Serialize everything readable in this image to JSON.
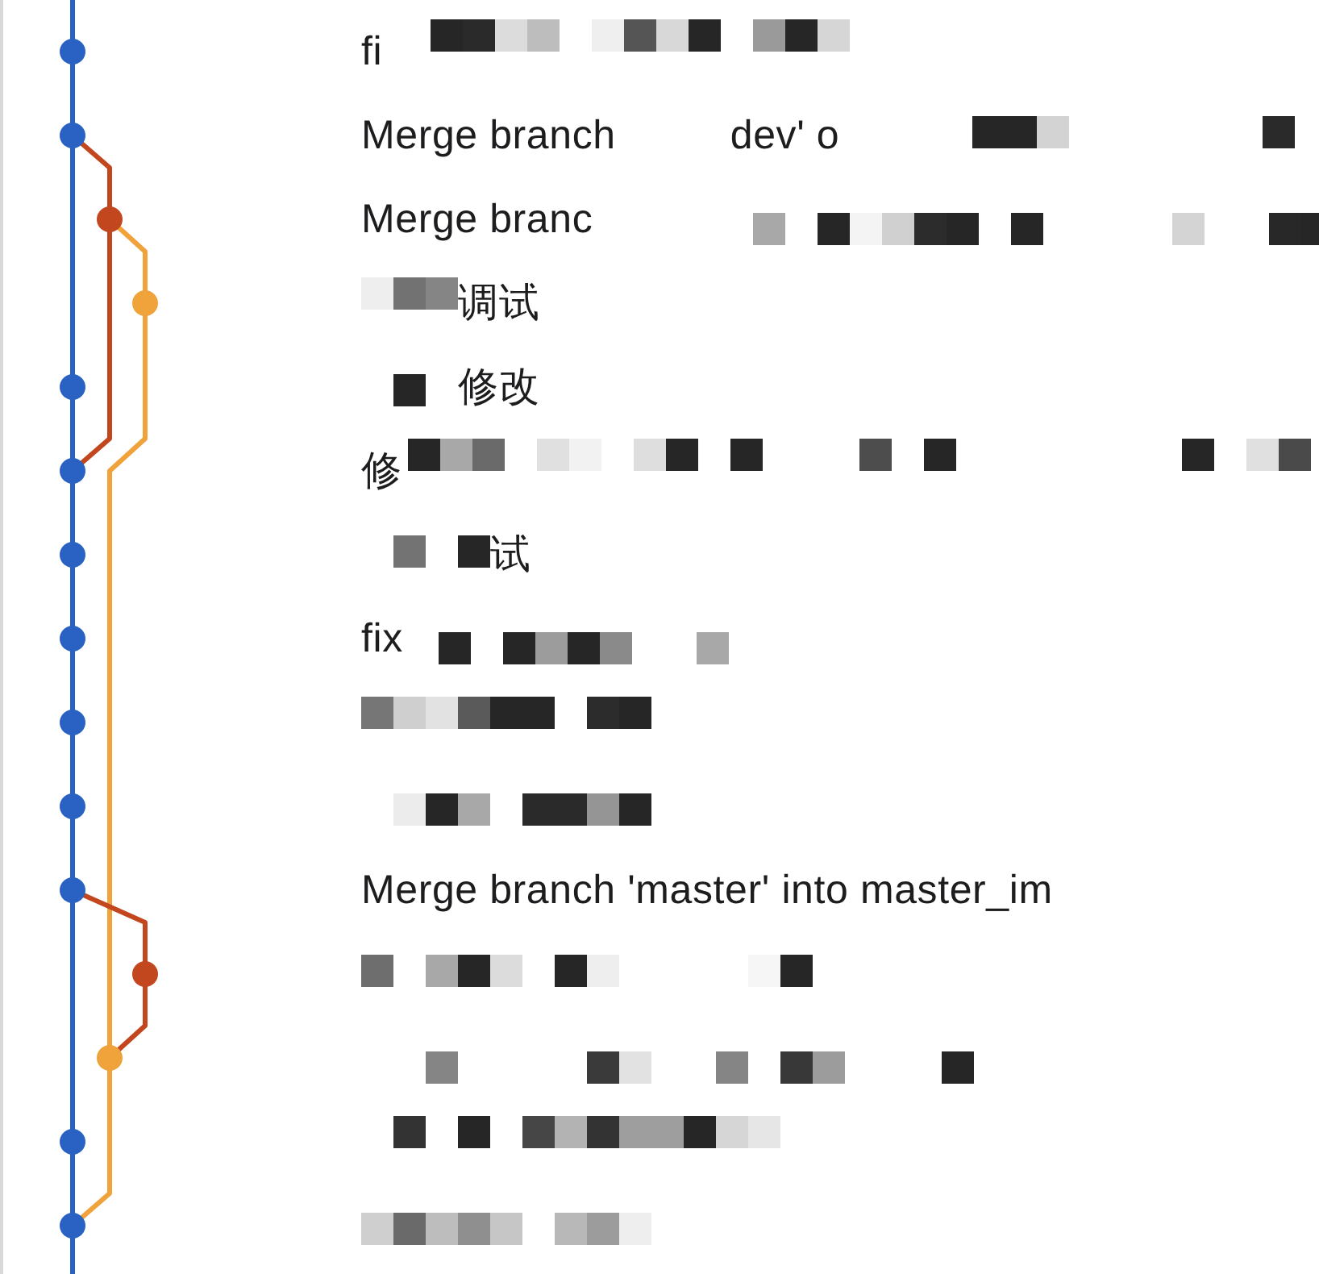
{
  "commits": [
    {
      "color": "#2a62c4",
      "kind": "main",
      "message": [
        {
          "kind": "text",
          "text": "fi"
        },
        {
          "kind": "mosaic",
          "tiles": [
            {
              "kind": "blank"
            },
            {
              "kind": "tile",
              "color": "#262626"
            },
            {
              "kind": "tile",
              "color": "#2a2a2a"
            },
            {
              "kind": "tile",
              "color": "#dcdcdc"
            },
            {
              "kind": "tile",
              "color": "#bdbdbd"
            },
            {
              "kind": "blank"
            },
            {
              "kind": "tile",
              "color": "#efefef"
            },
            {
              "kind": "tile",
              "color": "#555555"
            },
            {
              "kind": "tile",
              "color": "#d8d8d8"
            },
            {
              "kind": "tile",
              "color": "#262626"
            },
            {
              "kind": "blank"
            },
            {
              "kind": "tile",
              "color": "#9a9a9a"
            },
            {
              "kind": "tile",
              "color": "#262626"
            },
            {
              "kind": "tile",
              "color": "#d6d6d6"
            }
          ]
        }
      ]
    },
    {
      "color": "#2a62c4",
      "kind": "main",
      "message": [
        {
          "kind": "text",
          "text": "Merge branch"
        },
        {
          "kind": "mosaic",
          "tiles": [
            {
              "kind": "blank"
            },
            {
              "kind": "blank"
            },
            {
              "kind": "blank"
            }
          ]
        },
        {
          "kind": "text",
          "text": "dev' o"
        },
        {
          "kind": "mosaic",
          "tiles": [
            {
              "kind": "blank"
            },
            {
              "kind": "blank"
            },
            {
              "kind": "blank"
            },
            {
              "kind": "blank"
            },
            {
              "kind": "tile",
              "color": "#262626"
            },
            {
              "kind": "tile",
              "color": "#262626"
            },
            {
              "kind": "tile",
              "color": "#d3d3d3"
            },
            {
              "kind": "blank"
            },
            {
              "kind": "blank"
            },
            {
              "kind": "blank"
            },
            {
              "kind": "blank"
            },
            {
              "kind": "blank"
            },
            {
              "kind": "blank"
            },
            {
              "kind": "tile",
              "color": "#2a2a2a"
            }
          ]
        }
      ]
    },
    {
      "color": "#c2461e",
      "kind": "inner",
      "message": [
        {
          "kind": "text",
          "text": "Merge branc"
        },
        {
          "kind": "mosaic",
          "tiles": [
            {
              "kind": "blank"
            },
            {
              "kind": "blank"
            },
            {
              "kind": "blank"
            },
            {
              "kind": "blank"
            },
            {
              "kind": "tile",
              "color": "#a8a8a8"
            },
            {
              "kind": "blank"
            },
            {
              "kind": "tile",
              "color": "#262626"
            },
            {
              "kind": "tile",
              "color": "#f4f4f4"
            },
            {
              "kind": "tile",
              "color": "#d0d0d0"
            },
            {
              "kind": "tile",
              "color": "#2c2c2c"
            },
            {
              "kind": "tile",
              "color": "#262626"
            },
            {
              "kind": "blank"
            },
            {
              "kind": "tile",
              "color": "#262626"
            },
            {
              "kind": "blank"
            },
            {
              "kind": "blank"
            },
            {
              "kind": "blank"
            },
            {
              "kind": "blank"
            },
            {
              "kind": "tile",
              "color": "#d4d4d4"
            },
            {
              "kind": "blank"
            },
            {
              "kind": "blank"
            },
            {
              "kind": "tile",
              "color": "#282828"
            },
            {
              "kind": "tile",
              "color": "#262626"
            }
          ]
        }
      ]
    },
    {
      "color": "#f0a23b",
      "kind": "outer",
      "message": [
        {
          "kind": "mosaic",
          "tiles": [
            {
              "kind": "tile",
              "color": "#eeeeee"
            },
            {
              "kind": "tile",
              "color": "#727272"
            },
            {
              "kind": "tile",
              "color": "#858585"
            }
          ]
        },
        {
          "kind": "text",
          "text": "调试"
        }
      ]
    },
    {
      "color": "#2a62c4",
      "kind": "main",
      "message": [
        {
          "kind": "mosaic",
          "tiles": [
            {
              "kind": "blank"
            },
            {
              "kind": "tile",
              "color": "#262626"
            },
            {
              "kind": "blank"
            }
          ]
        },
        {
          "kind": "text",
          "text": "修改"
        }
      ]
    },
    {
      "color": "#2a62c4",
      "kind": "main",
      "message": [
        {
          "kind": "text",
          "text": "修"
        },
        {
          "kind": "mosaic",
          "tiles": [
            {
              "kind": "tile",
              "color": "#262626"
            },
            {
              "kind": "tile",
              "color": "#a8a8a8"
            },
            {
              "kind": "tile",
              "color": "#6a6a6a"
            },
            {
              "kind": "blank"
            },
            {
              "kind": "tile",
              "color": "#e0e0e0"
            },
            {
              "kind": "tile",
              "color": "#f2f2f2"
            },
            {
              "kind": "blank"
            },
            {
              "kind": "tile",
              "color": "#dedede"
            },
            {
              "kind": "tile",
              "color": "#262626"
            },
            {
              "kind": "blank"
            },
            {
              "kind": "tile",
              "color": "#262626"
            },
            {
              "kind": "blank"
            },
            {
              "kind": "blank"
            },
            {
              "kind": "blank"
            },
            {
              "kind": "tile",
              "color": "#4d4d4d"
            },
            {
              "kind": "blank"
            },
            {
              "kind": "tile",
              "color": "#262626"
            },
            {
              "kind": "blank"
            },
            {
              "kind": "blank"
            },
            {
              "kind": "blank"
            },
            {
              "kind": "blank"
            },
            {
              "kind": "blank"
            },
            {
              "kind": "blank"
            },
            {
              "kind": "blank"
            },
            {
              "kind": "tile",
              "color": "#262626"
            },
            {
              "kind": "blank"
            },
            {
              "kind": "tile",
              "color": "#e0e0e0"
            },
            {
              "kind": "tile",
              "color": "#4a4a4a"
            }
          ]
        }
      ]
    },
    {
      "color": "#2a62c4",
      "kind": "main",
      "message": [
        {
          "kind": "mosaic",
          "tiles": [
            {
              "kind": "blank"
            },
            {
              "kind": "tile",
              "color": "#737373"
            },
            {
              "kind": "blank"
            },
            {
              "kind": "tile",
              "color": "#262626"
            }
          ]
        },
        {
          "kind": "text",
          "text": "试"
        }
      ]
    },
    {
      "color": "#2a62c4",
      "kind": "main",
      "message": [
        {
          "kind": "text",
          "text": "fix"
        },
        {
          "kind": "mosaic",
          "tiles": [
            {
              "kind": "blank"
            },
            {
              "kind": "tile",
              "color": "#262626"
            },
            {
              "kind": "blank"
            },
            {
              "kind": "tile",
              "color": "#262626"
            },
            {
              "kind": "tile",
              "color": "#9c9c9c"
            },
            {
              "kind": "tile",
              "color": "#262626"
            },
            {
              "kind": "tile",
              "color": "#8a8a8a"
            },
            {
              "kind": "blank"
            },
            {
              "kind": "blank"
            },
            {
              "kind": "tile",
              "color": "#a8a8a8"
            }
          ]
        }
      ]
    },
    {
      "color": "#2a62c4",
      "kind": "main",
      "message": [
        {
          "kind": "mosaic",
          "tiles": [
            {
              "kind": "tile",
              "color": "#767676"
            },
            {
              "kind": "tile",
              "color": "#cfcfcf"
            },
            {
              "kind": "tile",
              "color": "#e2e2e2"
            },
            {
              "kind": "tile",
              "color": "#5a5a5a"
            },
            {
              "kind": "tile",
              "color": "#262626"
            },
            {
              "kind": "tile",
              "color": "#262626"
            },
            {
              "kind": "blank"
            },
            {
              "kind": "tile",
              "color": "#2c2c2c"
            },
            {
              "kind": "tile",
              "color": "#262626"
            }
          ]
        }
      ]
    },
    {
      "color": "#2a62c4",
      "kind": "main",
      "message": [
        {
          "kind": "mosaic",
          "tiles": [
            {
              "kind": "blank"
            },
            {
              "kind": "tile",
              "color": "#ececec"
            },
            {
              "kind": "tile",
              "color": "#262626"
            },
            {
              "kind": "tile",
              "color": "#a8a8a8"
            },
            {
              "kind": "blank"
            },
            {
              "kind": "tile",
              "color": "#2a2a2a"
            },
            {
              "kind": "tile",
              "color": "#2a2a2a"
            },
            {
              "kind": "tile",
              "color": "#959595"
            },
            {
              "kind": "tile",
              "color": "#262626"
            }
          ]
        }
      ]
    },
    {
      "color": "#2a62c4",
      "kind": "main",
      "message": [
        {
          "kind": "text",
          "text": "Merge branch 'master' into master_im"
        }
      ]
    },
    {
      "color": "#c2461e",
      "kind": "outer",
      "message": [
        {
          "kind": "mosaic",
          "tiles": [
            {
              "kind": "tile",
              "color": "#6e6e6e"
            },
            {
              "kind": "blank"
            },
            {
              "kind": "tile",
              "color": "#a8a8a8"
            },
            {
              "kind": "tile",
              "color": "#262626"
            },
            {
              "kind": "tile",
              "color": "#dcdcdc"
            },
            {
              "kind": "blank"
            },
            {
              "kind": "tile",
              "color": "#262626"
            },
            {
              "kind": "tile",
              "color": "#eeeeee"
            },
            {
              "kind": "blank"
            },
            {
              "kind": "blank"
            },
            {
              "kind": "blank"
            },
            {
              "kind": "blank"
            },
            {
              "kind": "tile",
              "color": "#f6f6f6"
            },
            {
              "kind": "tile",
              "color": "#262626"
            }
          ]
        }
      ]
    },
    {
      "color": "#f0a23b",
      "kind": "inner",
      "message": [
        {
          "kind": "mosaic",
          "tiles": [
            {
              "kind": "blank"
            },
            {
              "kind": "blank"
            },
            {
              "kind": "tile",
              "color": "#858585"
            },
            {
              "kind": "blank"
            },
            {
              "kind": "blank"
            },
            {
              "kind": "blank"
            },
            {
              "kind": "blank"
            },
            {
              "kind": "tile",
              "color": "#3a3a3a"
            },
            {
              "kind": "tile",
              "color": "#e2e2e2"
            },
            {
              "kind": "blank"
            },
            {
              "kind": "blank"
            },
            {
              "kind": "tile",
              "color": "#858585"
            },
            {
              "kind": "blank"
            },
            {
              "kind": "tile",
              "color": "#383838"
            },
            {
              "kind": "tile",
              "color": "#9c9c9c"
            },
            {
              "kind": "blank"
            },
            {
              "kind": "blank"
            },
            {
              "kind": "blank"
            },
            {
              "kind": "tile",
              "color": "#262626"
            }
          ]
        }
      ]
    },
    {
      "color": "#2a62c4",
      "kind": "main",
      "message": [
        {
          "kind": "mosaic",
          "tiles": [
            {
              "kind": "blank"
            },
            {
              "kind": "tile",
              "color": "#333333"
            },
            {
              "kind": "blank"
            },
            {
              "kind": "tile",
              "color": "#262626"
            },
            {
              "kind": "blank"
            },
            {
              "kind": "tile",
              "color": "#464646"
            },
            {
              "kind": "tile",
              "color": "#b3b3b3"
            },
            {
              "kind": "tile",
              "color": "#333333"
            },
            {
              "kind": "tile",
              "color": "#9e9e9e"
            },
            {
              "kind": "tile",
              "color": "#9e9e9e"
            },
            {
              "kind": "tile",
              "color": "#262626"
            },
            {
              "kind": "tile",
              "color": "#d6d6d6"
            },
            {
              "kind": "tile",
              "color": "#e6e6e6"
            }
          ]
        }
      ]
    },
    {
      "color": "#2a62c4",
      "kind": "main",
      "message": [
        {
          "kind": "mosaic",
          "tiles": [
            {
              "kind": "tile",
              "color": "#cfcfcf"
            },
            {
              "kind": "tile",
              "color": "#6a6a6a"
            },
            {
              "kind": "tile",
              "color": "#bdbdbd"
            },
            {
              "kind": "tile",
              "color": "#8f8f8f"
            },
            {
              "kind": "tile",
              "color": "#c6c6c6"
            },
            {
              "kind": "blank"
            },
            {
              "kind": "tile",
              "color": "#b8b8b8"
            },
            {
              "kind": "tile",
              "color": "#9c9c9c"
            },
            {
              "kind": "tile",
              "color": "#eeeeee"
            }
          ]
        }
      ]
    }
  ]
}
